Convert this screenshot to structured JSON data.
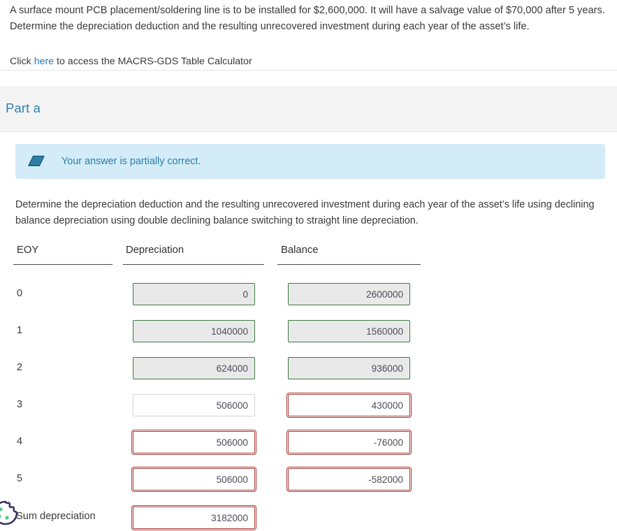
{
  "problem": {
    "statement": "A surface mount PCB placement/soldering line is to be installed for $2,600,000. It will have a salvage value of $70,000 after 5 years. Determine the depreciation deduction and the resulting unrecovered investment during each year of the asset’s life.",
    "click_prefix": "Click ",
    "link_label": "here",
    "click_suffix": " to access the MACRS-GDS Table Calculator"
  },
  "part": {
    "title": "Part a"
  },
  "alert": {
    "icon": "eraser-icon",
    "message": "Your answer is partially correct."
  },
  "instruction": {
    "text": "Determine the depreciation deduction and the resulting unrecovered investment during each year of the asset’s life using declining balance depreciation using double declining balance switching to straight line depreciation."
  },
  "table": {
    "headers": {
      "eoy": "EOY",
      "depreciation": "Depreciation",
      "balance": "Balance"
    },
    "rows": [
      {
        "eoy": "0",
        "depreciation": "0",
        "dep_state": "ok",
        "balance": "2600000",
        "bal_state": "ok"
      },
      {
        "eoy": "1",
        "depreciation": "1040000",
        "dep_state": "ok",
        "balance": "1560000",
        "bal_state": "ok"
      },
      {
        "eoy": "2",
        "depreciation": "624000",
        "dep_state": "ok",
        "balance": "936000",
        "bal_state": "ok"
      },
      {
        "eoy": "3",
        "depreciation": "506000",
        "dep_state": "neutral",
        "balance": "430000",
        "bal_state": "bad"
      },
      {
        "eoy": "4",
        "depreciation": "506000",
        "dep_state": "bad",
        "balance": "-76000",
        "bal_state": "bad"
      },
      {
        "eoy": "5",
        "depreciation": "506000",
        "dep_state": "bad",
        "balance": "-582000",
        "bal_state": "bad"
      }
    ],
    "summary": {
      "label": "Sum depreciation",
      "value": "3182000",
      "state": "bad"
    }
  },
  "cookie_widget": {
    "icon": "cookie-icon"
  },
  "colors": {
    "link": "#1f7bc1",
    "part_title": "#2d80b4",
    "alert_bg": "#d3ecf7",
    "alert_text": "#2c7ea8",
    "correct_border": "#3d7a42",
    "incorrect_border": "#a93b38",
    "locked_bg": "#e9e9e9",
    "band_bg": "#f4f4f4"
  }
}
